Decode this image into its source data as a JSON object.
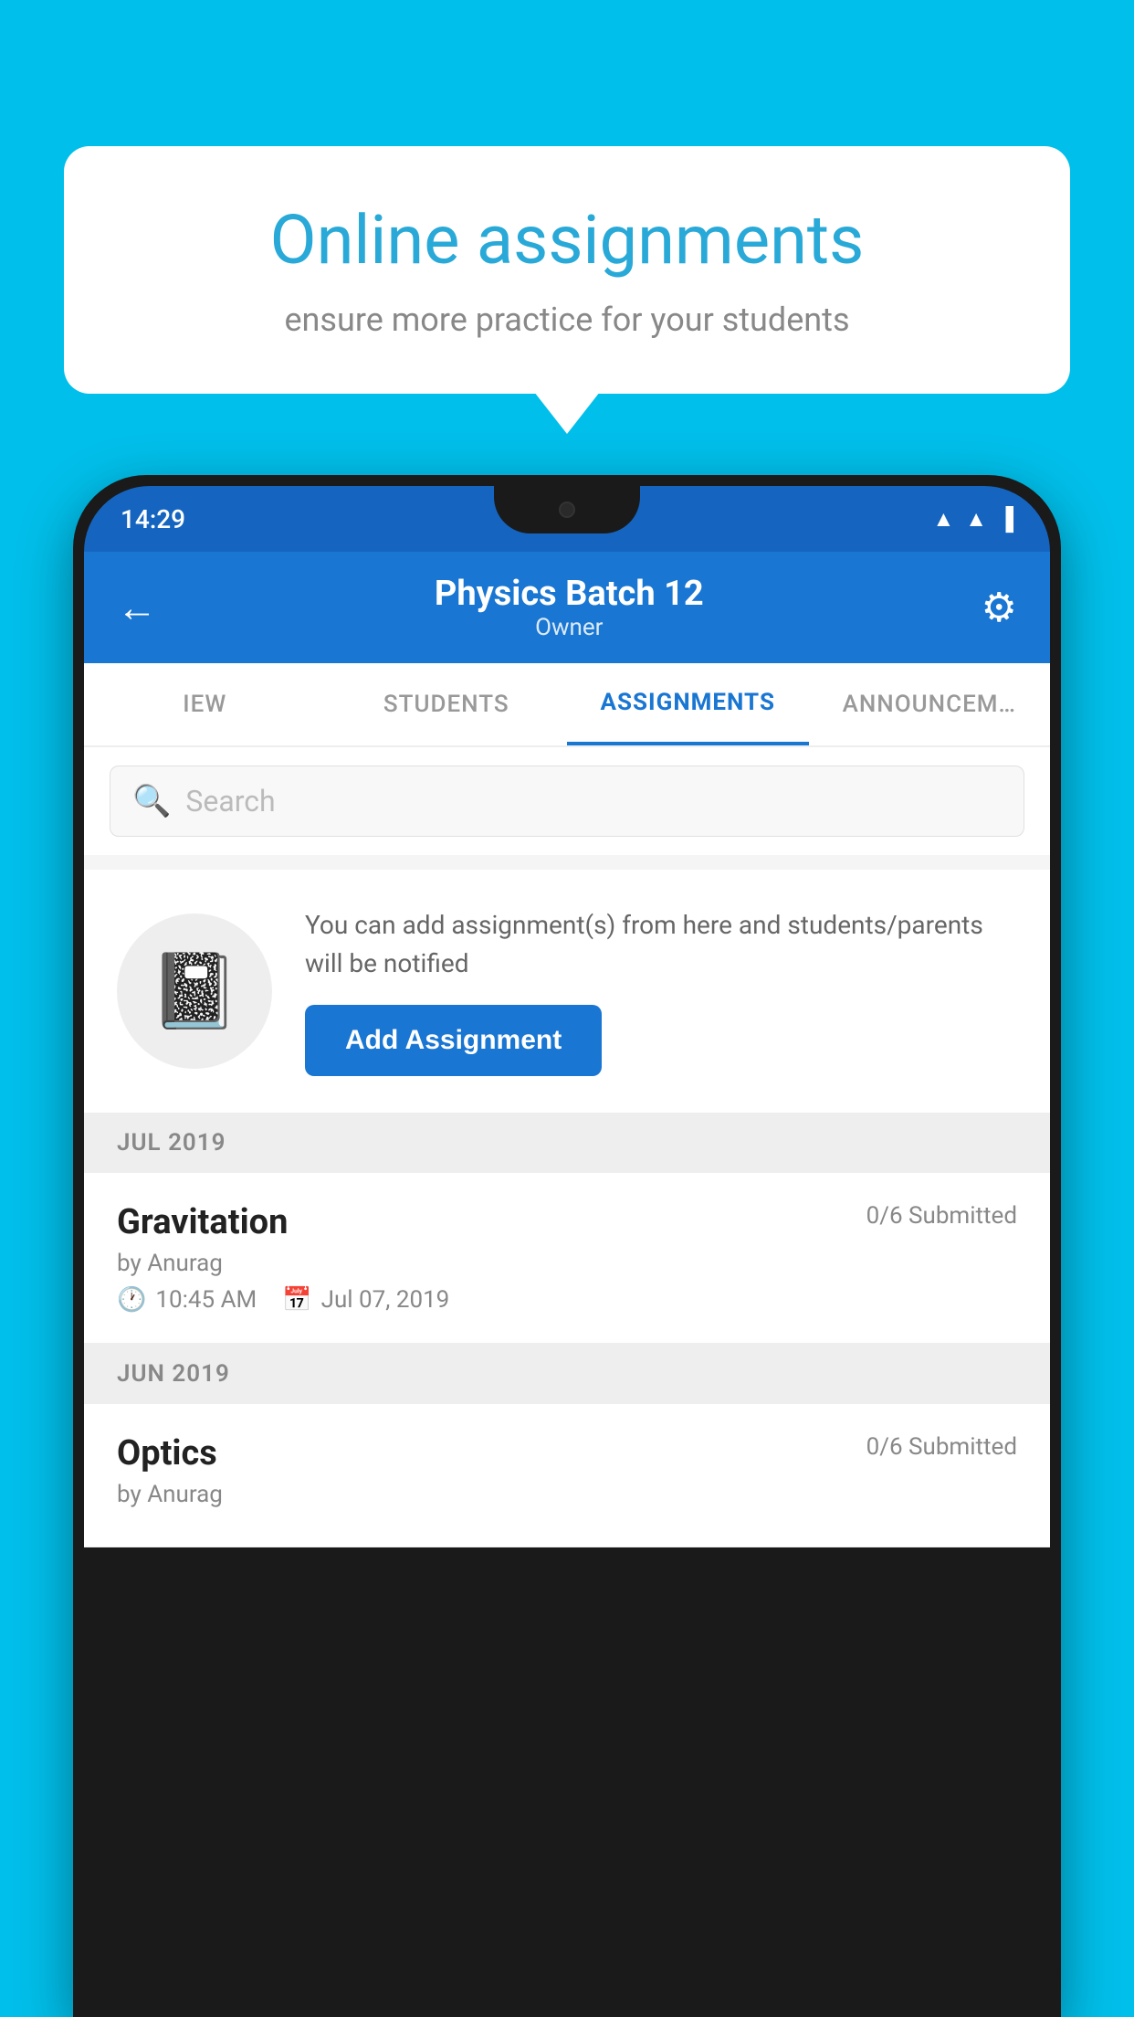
{
  "background_color": "#00BFEA",
  "speech_bubble": {
    "title": "Online assignments",
    "subtitle": "ensure more practice for your students"
  },
  "status_bar": {
    "time": "14:29",
    "icons": [
      "wifi",
      "signal",
      "battery"
    ]
  },
  "app_header": {
    "title": "Physics Batch 12",
    "subtitle": "Owner",
    "back_label": "←",
    "settings_label": "⚙"
  },
  "tabs": [
    {
      "label": "IEW",
      "active": false
    },
    {
      "label": "STUDENTS",
      "active": false
    },
    {
      "label": "ASSIGNMENTS",
      "active": true
    },
    {
      "label": "ANNOUNCEM…",
      "active": false
    }
  ],
  "search": {
    "placeholder": "Search"
  },
  "add_assignment_card": {
    "description": "You can add assignment(s) from here and students/parents will be notified",
    "button_label": "Add Assignment"
  },
  "sections": [
    {
      "month": "JUL 2019",
      "assignments": [
        {
          "name": "Gravitation",
          "submitted": "0/6 Submitted",
          "by": "by Anurag",
          "time": "10:45 AM",
          "date": "Jul 07, 2019"
        }
      ]
    },
    {
      "month": "JUN 2019",
      "assignments": [
        {
          "name": "Optics",
          "submitted": "0/6 Submitted",
          "by": "by Anurag",
          "time": "",
          "date": ""
        }
      ]
    }
  ]
}
